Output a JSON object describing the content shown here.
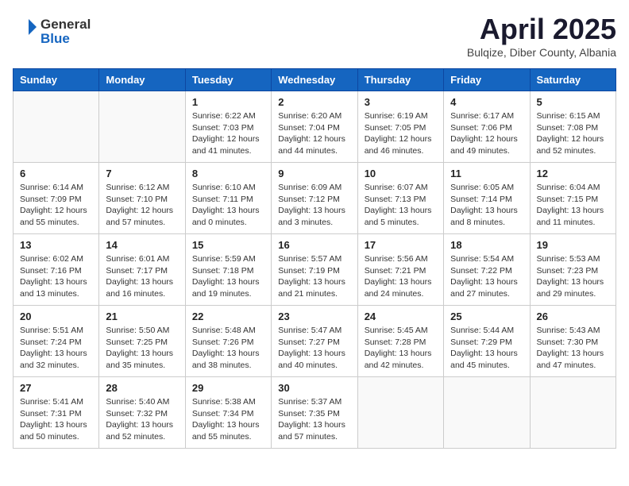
{
  "header": {
    "logo_general": "General",
    "logo_blue": "Blue",
    "month": "April 2025",
    "location": "Bulqize, Diber County, Albania"
  },
  "weekdays": [
    "Sunday",
    "Monday",
    "Tuesday",
    "Wednesday",
    "Thursday",
    "Friday",
    "Saturday"
  ],
  "weeks": [
    [
      {
        "day": "",
        "info": ""
      },
      {
        "day": "",
        "info": ""
      },
      {
        "day": "1",
        "info": "Sunrise: 6:22 AM\nSunset: 7:03 PM\nDaylight: 12 hours\nand 41 minutes."
      },
      {
        "day": "2",
        "info": "Sunrise: 6:20 AM\nSunset: 7:04 PM\nDaylight: 12 hours\nand 44 minutes."
      },
      {
        "day": "3",
        "info": "Sunrise: 6:19 AM\nSunset: 7:05 PM\nDaylight: 12 hours\nand 46 minutes."
      },
      {
        "day": "4",
        "info": "Sunrise: 6:17 AM\nSunset: 7:06 PM\nDaylight: 12 hours\nand 49 minutes."
      },
      {
        "day": "5",
        "info": "Sunrise: 6:15 AM\nSunset: 7:08 PM\nDaylight: 12 hours\nand 52 minutes."
      }
    ],
    [
      {
        "day": "6",
        "info": "Sunrise: 6:14 AM\nSunset: 7:09 PM\nDaylight: 12 hours\nand 55 minutes."
      },
      {
        "day": "7",
        "info": "Sunrise: 6:12 AM\nSunset: 7:10 PM\nDaylight: 12 hours\nand 57 minutes."
      },
      {
        "day": "8",
        "info": "Sunrise: 6:10 AM\nSunset: 7:11 PM\nDaylight: 13 hours\nand 0 minutes."
      },
      {
        "day": "9",
        "info": "Sunrise: 6:09 AM\nSunset: 7:12 PM\nDaylight: 13 hours\nand 3 minutes."
      },
      {
        "day": "10",
        "info": "Sunrise: 6:07 AM\nSunset: 7:13 PM\nDaylight: 13 hours\nand 5 minutes."
      },
      {
        "day": "11",
        "info": "Sunrise: 6:05 AM\nSunset: 7:14 PM\nDaylight: 13 hours\nand 8 minutes."
      },
      {
        "day": "12",
        "info": "Sunrise: 6:04 AM\nSunset: 7:15 PM\nDaylight: 13 hours\nand 11 minutes."
      }
    ],
    [
      {
        "day": "13",
        "info": "Sunrise: 6:02 AM\nSunset: 7:16 PM\nDaylight: 13 hours\nand 13 minutes."
      },
      {
        "day": "14",
        "info": "Sunrise: 6:01 AM\nSunset: 7:17 PM\nDaylight: 13 hours\nand 16 minutes."
      },
      {
        "day": "15",
        "info": "Sunrise: 5:59 AM\nSunset: 7:18 PM\nDaylight: 13 hours\nand 19 minutes."
      },
      {
        "day": "16",
        "info": "Sunrise: 5:57 AM\nSunset: 7:19 PM\nDaylight: 13 hours\nand 21 minutes."
      },
      {
        "day": "17",
        "info": "Sunrise: 5:56 AM\nSunset: 7:21 PM\nDaylight: 13 hours\nand 24 minutes."
      },
      {
        "day": "18",
        "info": "Sunrise: 5:54 AM\nSunset: 7:22 PM\nDaylight: 13 hours\nand 27 minutes."
      },
      {
        "day": "19",
        "info": "Sunrise: 5:53 AM\nSunset: 7:23 PM\nDaylight: 13 hours\nand 29 minutes."
      }
    ],
    [
      {
        "day": "20",
        "info": "Sunrise: 5:51 AM\nSunset: 7:24 PM\nDaylight: 13 hours\nand 32 minutes."
      },
      {
        "day": "21",
        "info": "Sunrise: 5:50 AM\nSunset: 7:25 PM\nDaylight: 13 hours\nand 35 minutes."
      },
      {
        "day": "22",
        "info": "Sunrise: 5:48 AM\nSunset: 7:26 PM\nDaylight: 13 hours\nand 38 minutes."
      },
      {
        "day": "23",
        "info": "Sunrise: 5:47 AM\nSunset: 7:27 PM\nDaylight: 13 hours\nand 40 minutes."
      },
      {
        "day": "24",
        "info": "Sunrise: 5:45 AM\nSunset: 7:28 PM\nDaylight: 13 hours\nand 42 minutes."
      },
      {
        "day": "25",
        "info": "Sunrise: 5:44 AM\nSunset: 7:29 PM\nDaylight: 13 hours\nand 45 minutes."
      },
      {
        "day": "26",
        "info": "Sunrise: 5:43 AM\nSunset: 7:30 PM\nDaylight: 13 hours\nand 47 minutes."
      }
    ],
    [
      {
        "day": "27",
        "info": "Sunrise: 5:41 AM\nSunset: 7:31 PM\nDaylight: 13 hours\nand 50 minutes."
      },
      {
        "day": "28",
        "info": "Sunrise: 5:40 AM\nSunset: 7:32 PM\nDaylight: 13 hours\nand 52 minutes."
      },
      {
        "day": "29",
        "info": "Sunrise: 5:38 AM\nSunset: 7:34 PM\nDaylight: 13 hours\nand 55 minutes."
      },
      {
        "day": "30",
        "info": "Sunrise: 5:37 AM\nSunset: 7:35 PM\nDaylight: 13 hours\nand 57 minutes."
      },
      {
        "day": "",
        "info": ""
      },
      {
        "day": "",
        "info": ""
      },
      {
        "day": "",
        "info": ""
      }
    ]
  ]
}
